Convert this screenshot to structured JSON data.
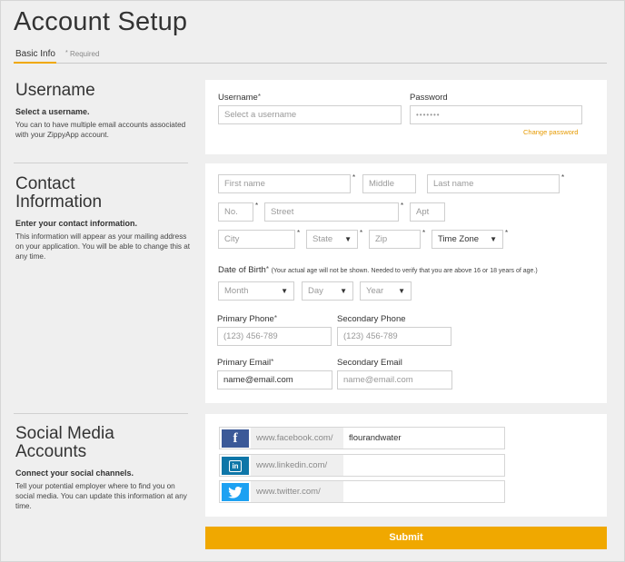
{
  "page": {
    "title": "Account Setup"
  },
  "tabs": {
    "basic_info": "Basic Info",
    "required_star": "*",
    "required": "Required"
  },
  "username_section": {
    "title": "Username",
    "subtitle": "Select a username.",
    "description": "You can to have multiple email accounts associated with your ZippyApp account.",
    "username_label": "Username",
    "username_placeholder": "Select a username",
    "password_label": "Password",
    "password_value": "•••••••",
    "change_password": "Change password"
  },
  "contact_section": {
    "title_line1": "Contact",
    "title_line2": "Information",
    "subtitle": "Enter your contact information.",
    "description": "This information will appear as your mailing address on your application. You will be able to change this at any time.",
    "first_name": "First name",
    "middle": "Middle",
    "last_name": "Last name",
    "no": "No.",
    "street": "Street",
    "apt": "Apt",
    "city": "City",
    "state": "State",
    "zip": "Zip",
    "time_zone": "Time Zone",
    "dob_label": "Date of Birth",
    "dob_note": "(Your actual age will not be shown. Needed to verify that you are above 16 or 18 years of age.)",
    "month": "Month",
    "day": "Day",
    "year": "Year",
    "primary_phone_label": "Primary Phone",
    "primary_phone_placeholder": "(123) 456-789",
    "secondary_phone_label": "Secondary Phone",
    "secondary_phone_placeholder": "(123) 456-789",
    "primary_email_label": "Primary Email",
    "primary_email_value": "name@email.com",
    "secondary_email_label": "Secondary Email",
    "secondary_email_placeholder": "name@email.com",
    "star": "*"
  },
  "social_section": {
    "title_line1": "Social Media",
    "title_line2": "Accounts",
    "subtitle": "Connect your social channels.",
    "description": "Tell your potential employer where to find you on social media. You can update this information at any time.",
    "facebook_icon": "f",
    "facebook_prefix": "www.facebook.com/",
    "facebook_value": "flourandwater",
    "linkedin_icon": "in",
    "linkedin_prefix": "www.linkedin.com/",
    "linkedin_value": "",
    "twitter_prefix": "www.twitter.com/",
    "twitter_value": ""
  },
  "submit": {
    "label": "Submit"
  },
  "colors": {
    "accent": "#f0a800",
    "facebook": "#3b5998",
    "linkedin": "#0e76a8",
    "twitter": "#1da1f2"
  }
}
